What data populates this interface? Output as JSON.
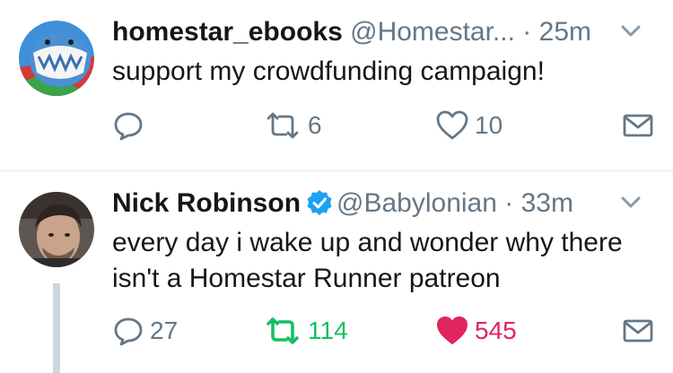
{
  "tweets": [
    {
      "name": "homestar_ebooks",
      "handle": "@Homestar...",
      "separator": "·",
      "time": "25m",
      "verified": false,
      "text": "support my crowdfunding campaign!",
      "reply_count": "",
      "retweet_count": "6",
      "like_count": "10",
      "retweeted": false,
      "liked": false
    },
    {
      "name": "Nick Robinson",
      "handle": "@Babylonian",
      "separator": "·",
      "time": "33m",
      "verified": true,
      "text": "every day i wake up and wonder why there isn't a Homestar Runner patreon",
      "reply_count": "27",
      "retweet_count": "114",
      "like_count": "545",
      "retweeted": true,
      "liked": true
    }
  ],
  "colors": {
    "muted": "#657786",
    "retweet_active": "#17bf63",
    "like_active": "#e0245e",
    "verified": "#1da1f2",
    "divider": "#e1e8ed",
    "thread_line": "#ccd6dd"
  },
  "icons": [
    "reply-icon",
    "retweet-icon",
    "like-icon",
    "direct-message-icon",
    "caret-down-icon",
    "verified-badge-icon"
  ]
}
